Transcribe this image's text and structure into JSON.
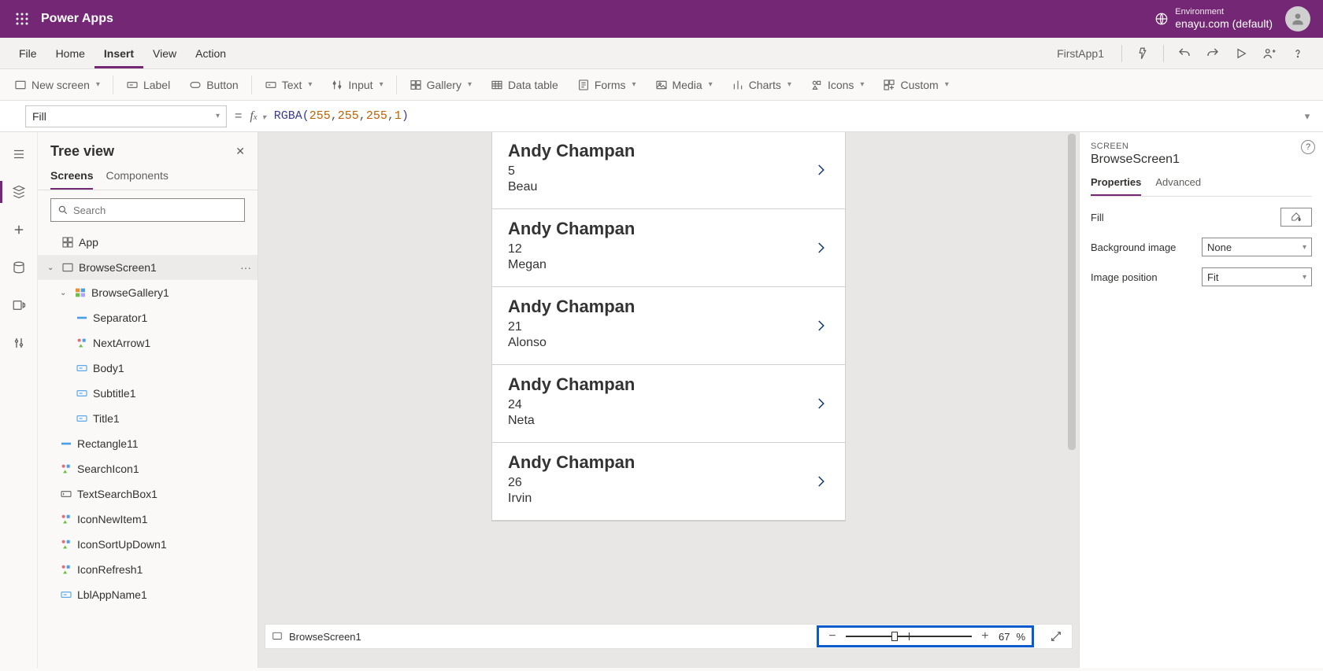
{
  "titlebar": {
    "brand": "Power Apps",
    "env_label": "Environment",
    "env_value": "enayu.com (default)"
  },
  "menubar": {
    "items": [
      "File",
      "Home",
      "Insert",
      "View",
      "Action"
    ],
    "active_index": 2,
    "app_name": "FirstApp1"
  },
  "ribbon": {
    "items": [
      {
        "label": "New screen",
        "dropdown": true
      },
      {
        "sep": true
      },
      {
        "label": "Label"
      },
      {
        "label": "Button"
      },
      {
        "sep": true
      },
      {
        "label": "Text",
        "dropdown": true
      },
      {
        "label": "Input",
        "dropdown": true
      },
      {
        "sep": true
      },
      {
        "label": "Gallery",
        "dropdown": true
      },
      {
        "label": "Data table"
      },
      {
        "label": "Forms",
        "dropdown": true
      },
      {
        "label": "Media",
        "dropdown": true
      },
      {
        "label": "Charts",
        "dropdown": true
      },
      {
        "label": "Icons",
        "dropdown": true
      },
      {
        "label": "Custom",
        "dropdown": true
      }
    ]
  },
  "fxbar": {
    "property": "Fill",
    "formula_tokens": [
      {
        "t": "fn",
        "v": "RGBA"
      },
      {
        "t": "par",
        "v": "("
      },
      {
        "t": "num",
        "v": "255"
      },
      {
        "t": "com",
        "v": ", "
      },
      {
        "t": "num",
        "v": "255"
      },
      {
        "t": "com",
        "v": ", "
      },
      {
        "t": "num",
        "v": "255"
      },
      {
        "t": "com",
        "v": ", "
      },
      {
        "t": "num",
        "v": "1"
      },
      {
        "t": "par",
        "v": ")"
      }
    ]
  },
  "tree": {
    "title": "Tree view",
    "tabs": [
      "Screens",
      "Components"
    ],
    "active_tab": 0,
    "search_placeholder": "Search",
    "nodes": [
      {
        "label": "App",
        "indent": 0,
        "icon": "app"
      },
      {
        "label": "BrowseScreen1",
        "indent": 0,
        "icon": "screen",
        "caret": "open",
        "sel": true,
        "more": true
      },
      {
        "label": "BrowseGallery1",
        "indent": 1,
        "icon": "gallery",
        "caret": "open"
      },
      {
        "label": "Separator1",
        "indent": 2,
        "icon": "separator"
      },
      {
        "label": "NextArrow1",
        "indent": 2,
        "icon": "icons"
      },
      {
        "label": "Body1",
        "indent": 2,
        "icon": "label"
      },
      {
        "label": "Subtitle1",
        "indent": 2,
        "icon": "label"
      },
      {
        "label": "Title1",
        "indent": 2,
        "icon": "label"
      },
      {
        "label": "Rectangle11",
        "indent": 1,
        "icon": "separator"
      },
      {
        "label": "SearchIcon1",
        "indent": 1,
        "icon": "icons"
      },
      {
        "label": "TextSearchBox1",
        "indent": 1,
        "icon": "textbox"
      },
      {
        "label": "IconNewItem1",
        "indent": 1,
        "icon": "icons"
      },
      {
        "label": "IconSortUpDown1",
        "indent": 1,
        "icon": "icons"
      },
      {
        "label": "IconRefresh1",
        "indent": 1,
        "icon": "icons"
      },
      {
        "label": "LblAppName1",
        "indent": 1,
        "icon": "label"
      }
    ]
  },
  "canvas": {
    "cards": [
      {
        "title": "Andy Champan",
        "sub": "5",
        "third": "Beau"
      },
      {
        "title": "Andy Champan",
        "sub": "12",
        "third": "Megan"
      },
      {
        "title": "Andy Champan",
        "sub": "21",
        "third": "Alonso"
      },
      {
        "title": "Andy Champan",
        "sub": "24",
        "third": "Neta"
      },
      {
        "title": "Andy Champan",
        "sub": "26",
        "third": "Irvin"
      }
    ]
  },
  "status": {
    "screen": "BrowseScreen1",
    "zoom": "67",
    "zoom_unit": "%"
  },
  "props": {
    "type": "SCREEN",
    "name": "BrowseScreen1",
    "tabs": [
      "Properties",
      "Advanced"
    ],
    "active_tab": 0,
    "rows": {
      "fill_label": "Fill",
      "bg_label": "Background image",
      "bg_value": "None",
      "pos_label": "Image position",
      "pos_value": "Fit"
    }
  }
}
